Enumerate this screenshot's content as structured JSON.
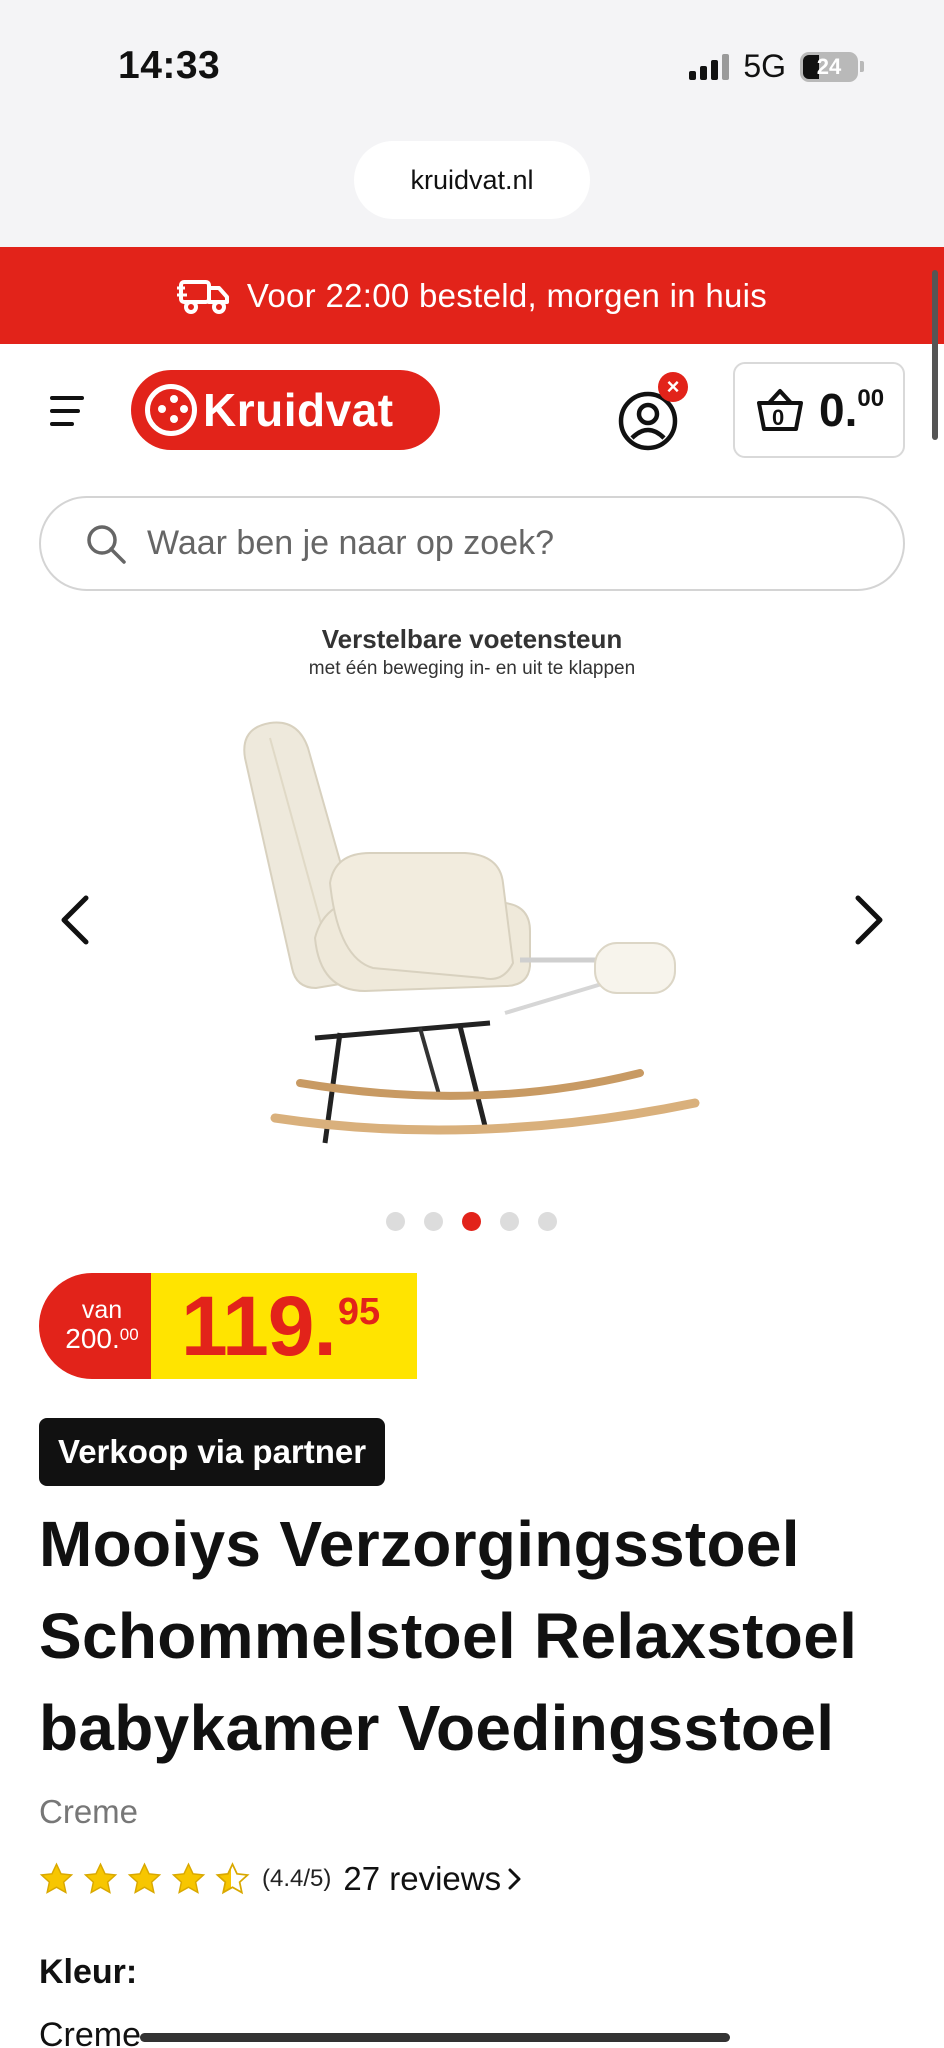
{
  "status_bar": {
    "time": "14:33",
    "network": "5G",
    "battery": "24"
  },
  "browser": {
    "url": "kruidvat.nl"
  },
  "banner": {
    "text": "Voor 22:00 besteld, morgen in huis",
    "color": "#e2231a",
    "icon": "delivery-truck-icon"
  },
  "header": {
    "logo_text": "Kruidvat",
    "account_badge": "×",
    "cart": {
      "count": "0",
      "amount_int": "0.",
      "amount_dec": "00"
    }
  },
  "search": {
    "placeholder": "Waar ben je naar op zoek?"
  },
  "gallery": {
    "image_title": "Verstelbare voetensteun",
    "image_subtitle": "met één beweging in- en uit te klappen",
    "slide_count": 5,
    "active_slide": 3
  },
  "price": {
    "van_label": "van",
    "old_int": "200.",
    "old_dec": "00",
    "new_int": "119.",
    "new_dec": "95"
  },
  "product": {
    "partner_badge": "Verkoop via partner",
    "title_lines": [
      "Mooiys Verzorgingsstoel",
      "Schommelstoel Relaxstoel",
      "babykamer Voedingsstoel"
    ],
    "variant": "Creme",
    "rating": {
      "value": 4.4,
      "score_text": "(4.4/5)",
      "reviews_text": "27 reviews"
    },
    "color_label": "Kleur:",
    "color_value": "Creme"
  }
}
